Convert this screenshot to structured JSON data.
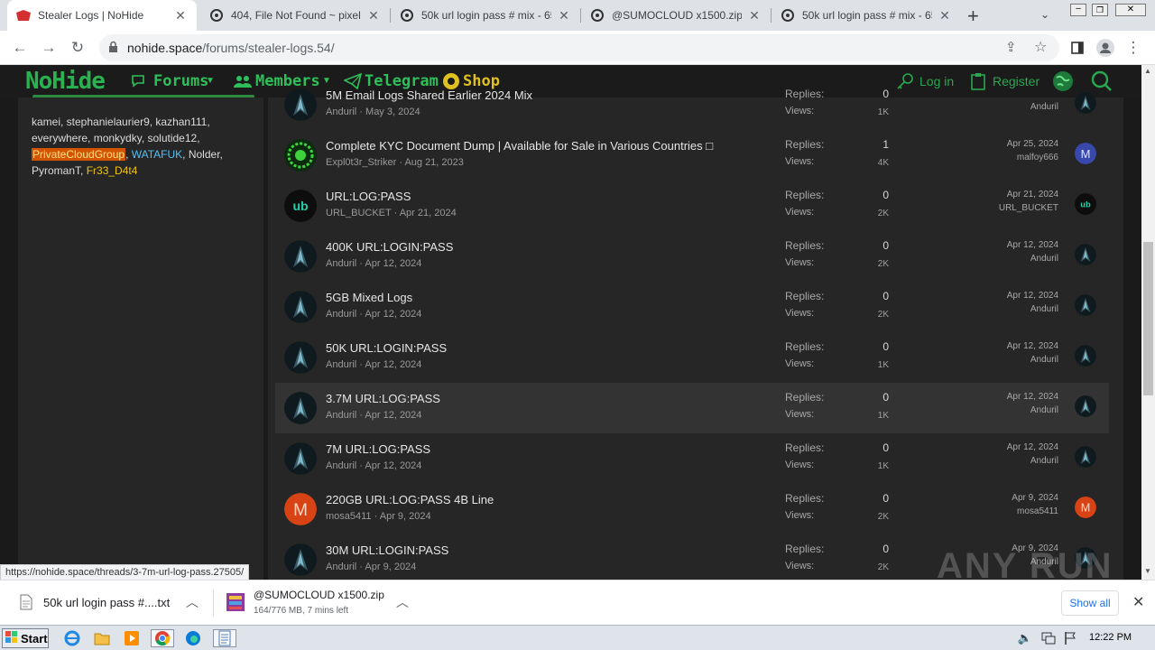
{
  "browser": {
    "tabs": [
      {
        "title": "Stealer Logs | NoHide",
        "active": true
      },
      {
        "title": "404, File Not Found ~ pixeldra",
        "active": false
      },
      {
        "title": "50k url login pass # mix - 65.tx",
        "active": false
      },
      {
        "title": "@SUMOCLOUD x1500.zip ~ pi",
        "active": false
      },
      {
        "title": "50k url login pass # mix - 65.tx",
        "active": false
      }
    ],
    "new_tab": "+",
    "url_host": "nohide.space",
    "url_path": "/forums/stealer-logs.54/"
  },
  "site": {
    "logo": "NoHide",
    "nav": {
      "forums": "Forums",
      "members": "Members",
      "telegram": "Telegram",
      "shop": "Shop",
      "login": "Log in",
      "register": "Register"
    },
    "online_users": {
      "plain1": "kamei, stephanielaurier9, kazhan111, everywhere, monkydky, solutide12, ",
      "priv": "PrivateCloudGroup",
      "sep1": ", ",
      "wata": "WATAFUK",
      "plain2": ", Nolder, PyromanT, ",
      "fr": "Fr33_D4t4"
    },
    "labels": {
      "replies": "Replies:",
      "views": "Views:"
    },
    "threads": [
      {
        "title": "5M Email Logs Shared Earlier 2024 Mix",
        "author": "Anduril",
        "date": "May 3, 2024",
        "replies": "0",
        "views": "1K",
        "last_date": "",
        "last_user": "Anduril",
        "avatar": "dark"
      },
      {
        "title": "Complete KYC Document Dump | Available for Sale in Various Countries □",
        "author": "Expl0t3r_Striker",
        "date": "Aug 21, 2023",
        "replies": "1",
        "views": "4K",
        "last_date": "Apr 25, 2024",
        "last_user": "malfoy666",
        "avatar": "green"
      },
      {
        "title": "URL:LOG:PASS",
        "author": "URL_BUCKET",
        "date": "Apr 21, 2024",
        "replies": "0",
        "views": "2K",
        "last_date": "Apr 21, 2024",
        "last_user": "URL_BUCKET",
        "avatar": "ub"
      },
      {
        "title": "400K URL:LOGIN:PASS",
        "author": "Anduril",
        "date": "Apr 12, 2024",
        "replies": "0",
        "views": "2K",
        "last_date": "Apr 12, 2024",
        "last_user": "Anduril",
        "avatar": "dark"
      },
      {
        "title": "5GB Mixed Logs",
        "author": "Anduril",
        "date": "Apr 12, 2024",
        "replies": "0",
        "views": "2K",
        "last_date": "Apr 12, 2024",
        "last_user": "Anduril",
        "avatar": "dark"
      },
      {
        "title": "50K URL:LOGIN:PASS",
        "author": "Anduril",
        "date": "Apr 12, 2024",
        "replies": "0",
        "views": "1K",
        "last_date": "Apr 12, 2024",
        "last_user": "Anduril",
        "avatar": "dark"
      },
      {
        "title": "3.7M URL:LOG:PASS",
        "author": "Anduril",
        "date": "Apr 12, 2024",
        "replies": "0",
        "views": "1K",
        "last_date": "Apr 12, 2024",
        "last_user": "Anduril",
        "avatar": "dark",
        "highlight": true
      },
      {
        "title": "7M URL:LOG:PASS",
        "author": "Anduril",
        "date": "Apr 12, 2024",
        "replies": "0",
        "views": "1K",
        "last_date": "Apr 12, 2024",
        "last_user": "Anduril",
        "avatar": "dark"
      },
      {
        "title": "220GB URL:LOG:PASS 4B Line",
        "author": "mosa5411",
        "date": "Apr 9, 2024",
        "replies": "0",
        "views": "2K",
        "last_date": "Apr 9, 2024",
        "last_user": "mosa5411",
        "avatar": "m"
      },
      {
        "title": "30M URL:LOGIN:PASS",
        "author": "Anduril",
        "date": "Apr 9, 2024",
        "replies": "0",
        "views": "2K",
        "last_date": "Apr 9, 2024",
        "last_user": "Anduril",
        "avatar": "dark"
      }
    ]
  },
  "status_url": "https://nohide.space/threads/3-7m-url-log-pass.27505/",
  "watermark": "ANY RUN",
  "downloads": {
    "items": [
      {
        "name": "50k url login pass #....txt",
        "sub": ""
      },
      {
        "name": "@SUMOCLOUD x1500.zip",
        "sub": "164/776 MB, 7 mins left"
      }
    ],
    "show_all": "Show all"
  },
  "taskbar": {
    "start": "Start",
    "clock": "12:22 PM"
  },
  "colors": {
    "accent_green": "#2fbf5a",
    "highlight_orange": "#d35400"
  }
}
